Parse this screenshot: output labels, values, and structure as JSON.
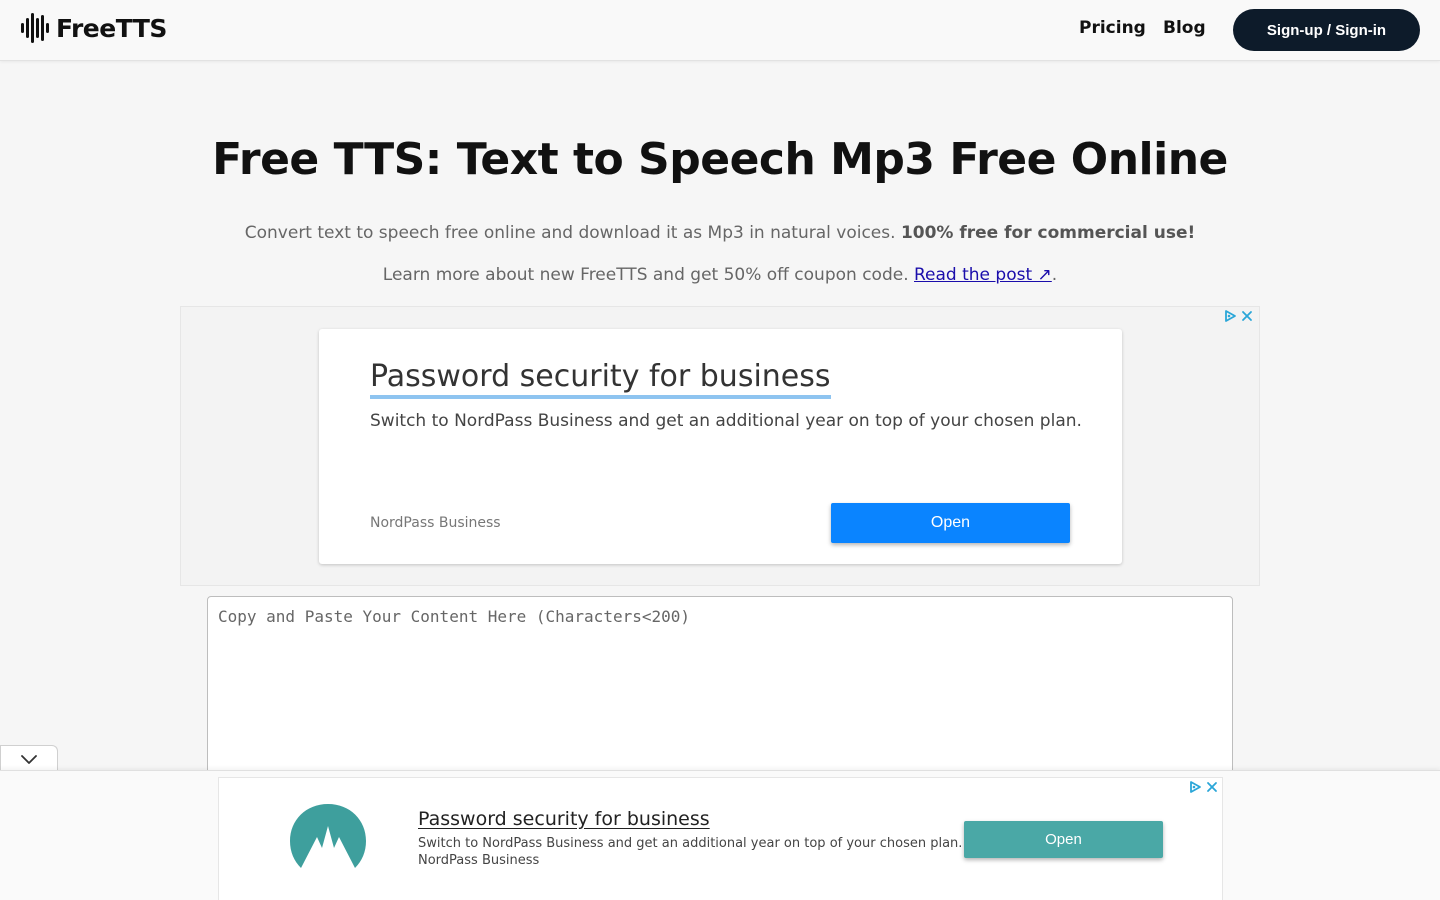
{
  "header": {
    "logo_text": "FreeTTS",
    "nav": [
      {
        "label": "Pricing"
      },
      {
        "label": "Blog"
      }
    ],
    "signin_label": "Sign-up / Sign-in"
  },
  "hero": {
    "title": "Free TTS: Text to Speech Mp3 Free Online",
    "subtitle": "Convert text to speech free online and download it as Mp3 in natural voices. ",
    "subtitle_bold": "100% free for commercial use!",
    "post_text": "Learn more about new FreeTTS and get 50% off coupon code. ",
    "post_link": "Read the post ↗",
    "post_end": "."
  },
  "ad_top": {
    "title": "Password security for business",
    "description": "Switch to NordPass Business and get an additional year on top of your chosen plan.",
    "brand": "NordPass Business",
    "button": "Open"
  },
  "editor": {
    "placeholder": "Copy and Paste Your Content Here (Characters<200)",
    "value": ""
  },
  "ad_bottom": {
    "title": "Password security for business",
    "description": "Switch to NordPass Business and get an additional year on top of your chosen plan.",
    "brand": "NordPass Business",
    "button": "Open"
  },
  "colors": {
    "primary_dark": "#0d1b2a",
    "link": "#1a0dab",
    "ad_button_blue": "#0a84ff",
    "ad_button_teal": "#4aa8a6"
  },
  "icons": [
    "soundwave-logo-icon",
    "ad-choices-icon",
    "close-icon",
    "chevron-down-icon",
    "mountain-logo-icon"
  ]
}
